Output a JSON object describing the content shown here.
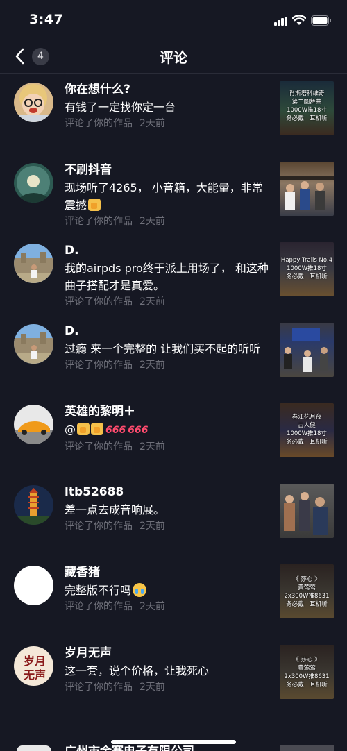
{
  "status_bar": {
    "time": "3:47"
  },
  "nav": {
    "back_count": "4",
    "title": "评论"
  },
  "comments": [
    {
      "name": "你在想什么?",
      "text": "有钱了一定找你定一台",
      "action": "评论了你的作品",
      "ago": "2天前",
      "thumb_caption": [
        "肖斯塔科维奇",
        "第二圆舞曲",
        "1000W推18寸",
        "务必戴　耳机听"
      ]
    },
    {
      "name": "不刷抖音",
      "text": "现场听了4265， 小音箱，大能量，非常震撼",
      "action": "评论了你的作品",
      "ago": "2天前",
      "thumb_caption": []
    },
    {
      "name": "D.",
      "text": "我的airpds pro终于派上用场了， 和这种曲子搭配才是真爱。",
      "action": "评论了你的作品",
      "ago": "2天前",
      "thumb_caption": [
        "Happy Trails No.4",
        "1000W推18寸",
        "务必戴　耳机听"
      ]
    },
    {
      "name": "D.",
      "text": "过瘾 来一个完整的 让我们买不起的听听",
      "action": "评论了你的作品",
      "ago": "2天前",
      "thumb_caption": []
    },
    {
      "name": "英雄的黎明＋",
      "text": "@",
      "action": "评论了你的作品",
      "ago": "2天前",
      "emoji_666": "666",
      "thumb_caption": [
        "春江花月夜",
        "古人健",
        "1000W推18寸",
        "务必戴　耳机听"
      ]
    },
    {
      "name": "ltb52688",
      "text": "差一点去成音响展。",
      "action": "评论了你的作品",
      "ago": "2天前",
      "thumb_caption": []
    },
    {
      "name": "藏香猪",
      "text": "完整版不行吗",
      "action": "评论了你的作品",
      "ago": "2天前",
      "thumb_caption": [
        "《 莎心 》",
        "黄莺莺",
        "2x300W推8631",
        "务必戴　耳机听"
      ]
    },
    {
      "name": "岁月无声",
      "text": "这一套，说个价格，让我死心",
      "action": "评论了你的作品",
      "ago": "2天前",
      "thumb_caption": [
        "《 莎心 》",
        "黄莺莺",
        "2x300W推8631",
        "务必戴　耳机听"
      ]
    }
  ],
  "partial_row": {
    "name": "广州市金赛电子有限公司"
  }
}
